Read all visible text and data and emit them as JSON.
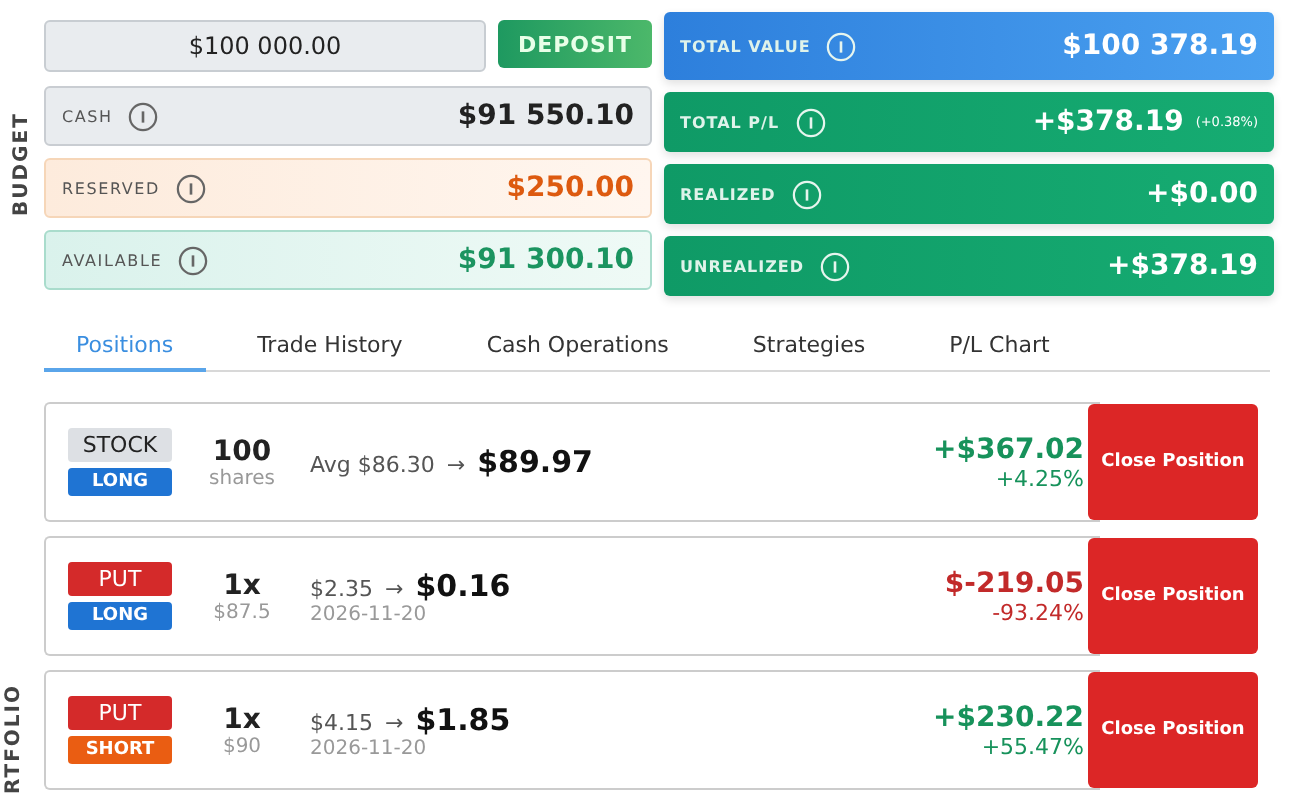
{
  "budget": {
    "section_label": "BUDGET",
    "deposit": {
      "value": "$100 000.00",
      "button": "DEPOSIT"
    },
    "rows": [
      {
        "label": "CASH",
        "value": "$91 550.10",
        "kind": "cash"
      },
      {
        "label": "RESERVED",
        "value": "$250.00",
        "kind": "reserved"
      },
      {
        "label": "AVAILABLE",
        "value": "$91 300.10",
        "kind": "available"
      }
    ]
  },
  "summary": [
    {
      "label": "TOTAL VALUE",
      "value": "$100 378.19",
      "kind": "blue"
    },
    {
      "label": "TOTAL P/L",
      "value": "+$378.19",
      "note": "(+0.38%)",
      "kind": "green"
    },
    {
      "label": "REALIZED",
      "value": "+$0.00",
      "kind": "green"
    },
    {
      "label": "UNREALIZED",
      "value": "+$378.19",
      "kind": "green"
    }
  ],
  "tabs": [
    {
      "label": "Positions",
      "selected": true
    },
    {
      "label": "Trade History",
      "selected": false
    },
    {
      "label": "Cash Operations",
      "selected": false
    },
    {
      "label": "Strategies",
      "selected": false
    },
    {
      "label": "P/L Chart",
      "selected": false
    }
  ],
  "portfolio": {
    "section_label": "RTFOLIO",
    "positions": [
      {
        "type": {
          "label": "STOCK",
          "kind": "stock"
        },
        "side": {
          "label": "LONG",
          "kind": "long"
        },
        "qty": "100",
        "qty_sub": "shares",
        "entry": "Avg $86.30",
        "arrow": "→",
        "current": "$89.97",
        "pnl": {
          "value": "+$367.02",
          "percent": "+4.25%",
          "kind": "gain"
        },
        "button": "Close Position"
      },
      {
        "type": {
          "label": "PUT",
          "kind": "put"
        },
        "side": {
          "label": "LONG",
          "kind": "long"
        },
        "qty": "1x",
        "qty_sub": "$87.5",
        "entry": "$2.35",
        "arrow": "→",
        "current": "$0.16",
        "expiry": "2026-11-20",
        "pnl": {
          "value": "$-219.05",
          "percent": "-93.24%",
          "kind": "loss"
        },
        "button": "Close Position"
      },
      {
        "type": {
          "label": "PUT",
          "kind": "put"
        },
        "side": {
          "label": "SHORT",
          "kind": "short"
        },
        "qty": "1x",
        "qty_sub": "$90",
        "entry": "$4.15",
        "arrow": "→",
        "current": "$1.85",
        "expiry": "2026-11-20",
        "pnl": {
          "value": "+$230.22",
          "percent": "+55.47%",
          "kind": "gain"
        },
        "button": "Close Position"
      }
    ]
  }
}
